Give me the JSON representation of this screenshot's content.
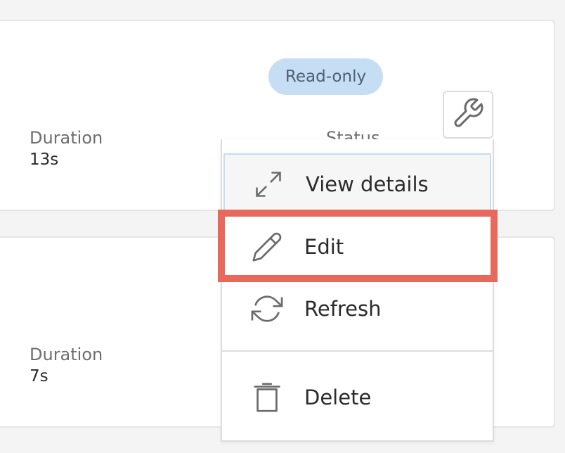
{
  "cards": [
    {
      "badge": "Read-only",
      "duration_label": "Duration",
      "duration_value": "13s",
      "status_label": "Status"
    },
    {
      "duration_label": "Duration",
      "duration_value": "7s"
    }
  ],
  "menu": {
    "items": [
      {
        "label": "View details",
        "icon": "expand-icon"
      },
      {
        "label": "Edit",
        "icon": "pencil-icon"
      },
      {
        "label": "Refresh",
        "icon": "refresh-icon"
      },
      {
        "label": "Delete",
        "icon": "trash-icon"
      }
    ]
  },
  "colors": {
    "highlight": "#e8685b",
    "badge_bg": "#c6def3",
    "focus_border": "#c5dcf2"
  }
}
